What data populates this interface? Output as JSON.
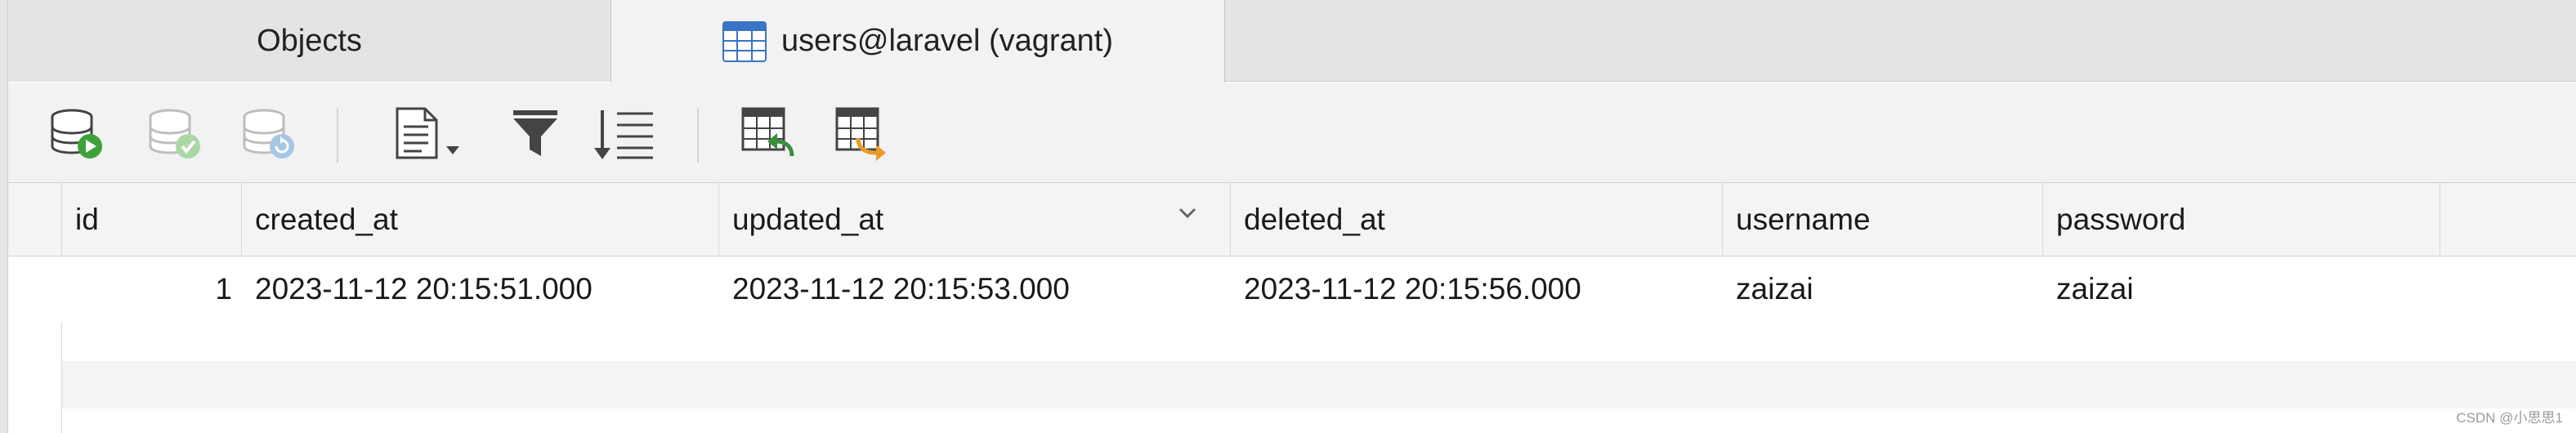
{
  "tabs": [
    {
      "label": "Objects"
    },
    {
      "label": "users@laravel (vagrant)",
      "icon": "table-icon"
    }
  ],
  "toolbar": {
    "buttons": [
      {
        "name": "begin-transaction-button",
        "icon": "database-play-icon",
        "enabled": true
      },
      {
        "name": "commit-button",
        "icon": "database-check-icon",
        "enabled": false
      },
      {
        "name": "rollback-button",
        "icon": "database-refresh-icon",
        "enabled": false
      },
      {
        "name": "text-view-button",
        "icon": "document-dropdown-icon",
        "enabled": true
      },
      {
        "name": "filter-button",
        "icon": "funnel-icon",
        "enabled": true
      },
      {
        "name": "sort-button",
        "icon": "sort-lines-icon",
        "enabled": true
      },
      {
        "name": "import-button",
        "icon": "table-import-icon",
        "enabled": true
      },
      {
        "name": "export-button",
        "icon": "table-export-icon",
        "enabled": true
      }
    ]
  },
  "grid": {
    "columns": [
      "id",
      "created_at",
      "updated_at",
      "deleted_at",
      "username",
      "password"
    ],
    "rows": [
      [
        "1",
        "2023-11-12 20:15:51.000",
        "2023-11-12 20:15:53.000",
        "2023-11-12 20:15:56.000",
        "zaizai",
        "zaizai"
      ]
    ]
  },
  "watermark": "CSDN @小思思1"
}
